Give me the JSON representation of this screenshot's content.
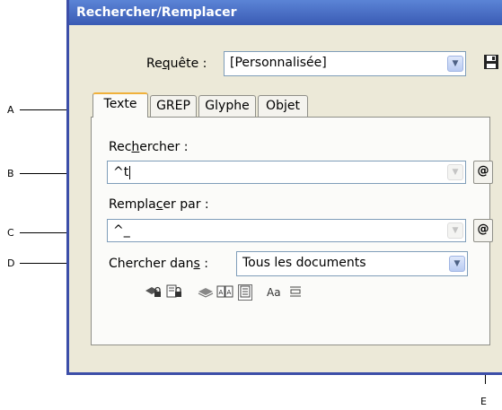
{
  "dialog": {
    "title": "Rechercher/Remplacer",
    "query_label_pre": "Re",
    "query_label_acc": "q",
    "query_label_post": "uête :",
    "query_value": "[Personnalisée]",
    "tabs": [
      "Texte",
      "GREP",
      "Glyphe",
      "Objet"
    ],
    "find_label_pre": "Rec",
    "find_label_acc": "h",
    "find_label_post": "ercher :",
    "find_value": "^t",
    "replace_label_pre": "Rempla",
    "replace_label_acc": "c",
    "replace_label_post": "er par :",
    "replace_value": "^_",
    "search_label_pre": "Chercher dan",
    "search_label_acc": "s",
    "search_label_post": " :",
    "search_value": "Tous les documents",
    "special_char_glyph": "@",
    "case_sensitive_label": "Aa"
  },
  "callouts": {
    "a": "A",
    "b": "B",
    "c": "C",
    "d": "D",
    "e": "E"
  },
  "icons": {
    "save": "save-query-icon",
    "special_chars": "special-characters-icon",
    "locked_layers": "include-locked-layers-icon",
    "locked_stories": "include-locked-stories-icon",
    "hidden_layers": "include-hidden-layers-icon",
    "master_pages": "include-master-pages-icon",
    "footnotes": "include-footnotes-icon",
    "case_sensitive": "case-sensitive-icon",
    "whole_word": "whole-word-icon"
  },
  "colors": {
    "titlebar": "#3a5bb4",
    "dialog_bg": "#ece9d8",
    "active_tab_accent": "#f0b13b"
  }
}
